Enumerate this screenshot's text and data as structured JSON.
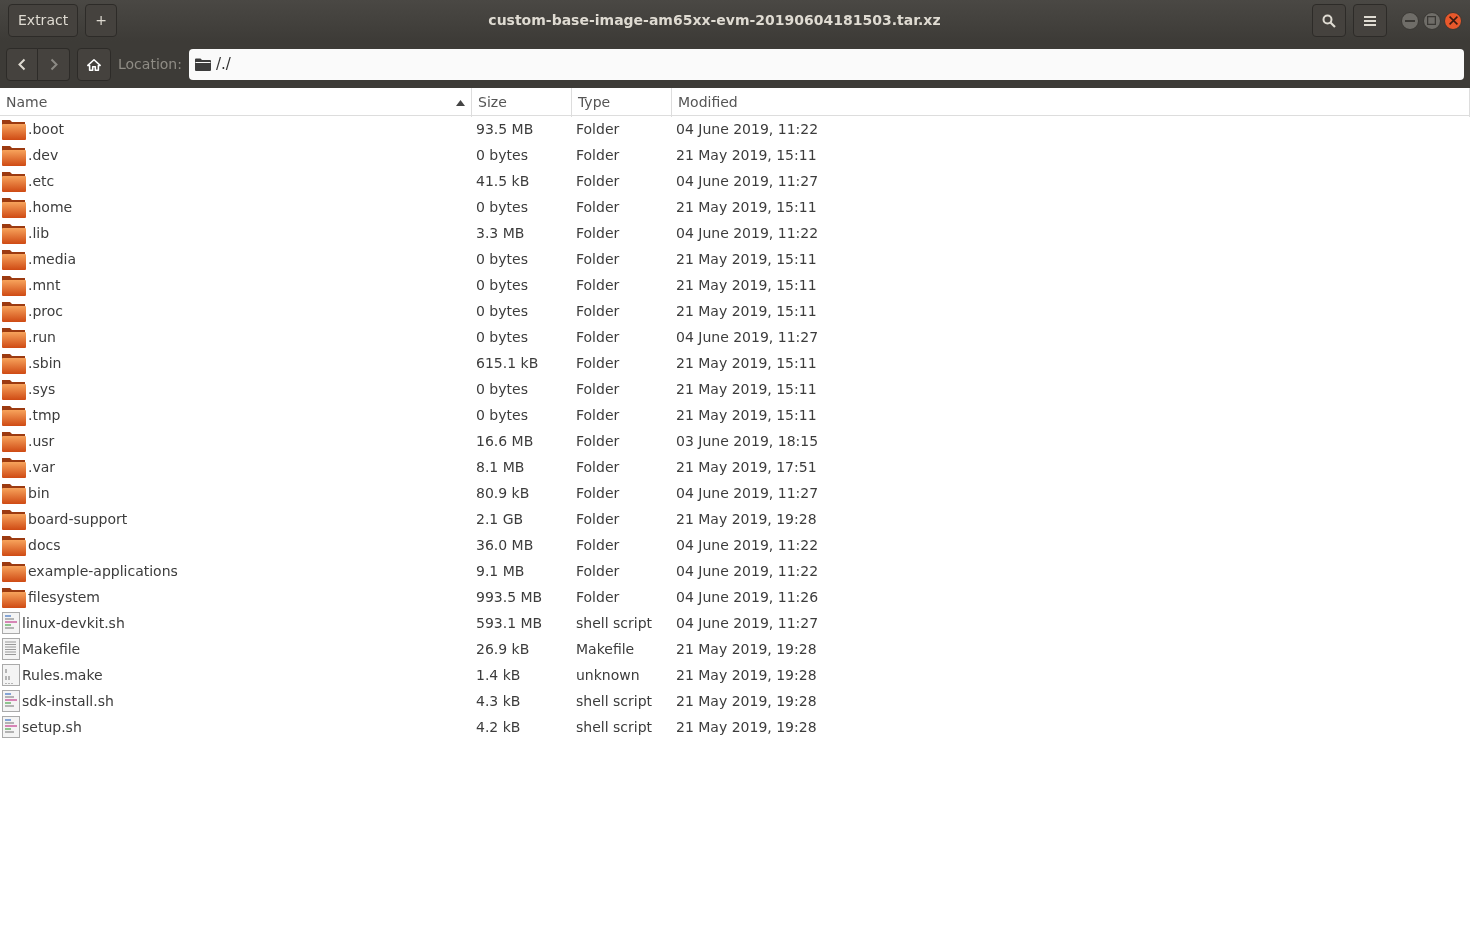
{
  "window": {
    "title": "custom-base-image-am65xx-evm-20190604181503.tar.xz"
  },
  "header_buttons": [
    {
      "label": "Extract",
      "kind": "text"
    },
    {
      "label": "+",
      "kind": "text"
    }
  ],
  "toolbar": {
    "location_label": "Location:",
    "path": "/./"
  },
  "table": {
    "columns": [
      {
        "label": "Name",
        "sorted": true
      },
      {
        "label": "Size",
        "sorted": false
      },
      {
        "label": "Type",
        "sorted": false
      },
      {
        "label": "Modified",
        "sorted": false
      }
    ],
    "rows": [
      {
        "kind": "folder",
        "name": ".boot",
        "size": "93.5 MB",
        "type": "Folder",
        "modified": "04 June 2019, 11:22"
      },
      {
        "kind": "folder",
        "name": ".dev",
        "size": "0 bytes",
        "type": "Folder",
        "modified": "21 May 2019, 15:11"
      },
      {
        "kind": "folder",
        "name": ".etc",
        "size": "41.5 kB",
        "type": "Folder",
        "modified": "04 June 2019, 11:27"
      },
      {
        "kind": "folder",
        "name": ".home",
        "size": "0 bytes",
        "type": "Folder",
        "modified": "21 May 2019, 15:11"
      },
      {
        "kind": "folder",
        "name": ".lib",
        "size": "3.3 MB",
        "type": "Folder",
        "modified": "04 June 2019, 11:22"
      },
      {
        "kind": "folder",
        "name": ".media",
        "size": "0 bytes",
        "type": "Folder",
        "modified": "21 May 2019, 15:11"
      },
      {
        "kind": "folder",
        "name": ".mnt",
        "size": "0 bytes",
        "type": "Folder",
        "modified": "21 May 2019, 15:11"
      },
      {
        "kind": "folder",
        "name": ".proc",
        "size": "0 bytes",
        "type": "Folder",
        "modified": "21 May 2019, 15:11"
      },
      {
        "kind": "folder",
        "name": ".run",
        "size": "0 bytes",
        "type": "Folder",
        "modified": "04 June 2019, 11:27"
      },
      {
        "kind": "folder",
        "name": ".sbin",
        "size": "615.1 kB",
        "type": "Folder",
        "modified": "21 May 2019, 15:11"
      },
      {
        "kind": "folder",
        "name": ".sys",
        "size": "0 bytes",
        "type": "Folder",
        "modified": "21 May 2019, 15:11"
      },
      {
        "kind": "folder",
        "name": ".tmp",
        "size": "0 bytes",
        "type": "Folder",
        "modified": "21 May 2019, 15:11"
      },
      {
        "kind": "folder",
        "name": ".usr",
        "size": "16.6 MB",
        "type": "Folder",
        "modified": "03 June 2019, 18:15"
      },
      {
        "kind": "folder",
        "name": ".var",
        "size": "8.1 MB",
        "type": "Folder",
        "modified": "21 May 2019, 17:51"
      },
      {
        "kind": "folder",
        "name": "bin",
        "size": "80.9 kB",
        "type": "Folder",
        "modified": "04 June 2019, 11:27"
      },
      {
        "kind": "folder",
        "name": "board-support",
        "size": "2.1 GB",
        "type": "Folder",
        "modified": "21 May 2019, 19:28"
      },
      {
        "kind": "folder",
        "name": "docs",
        "size": "36.0 MB",
        "type": "Folder",
        "modified": "04 June 2019, 11:22"
      },
      {
        "kind": "folder",
        "name": "example-applications",
        "size": "9.1 MB",
        "type": "Folder",
        "modified": "04 June 2019, 11:22"
      },
      {
        "kind": "folder",
        "name": "filesystem",
        "size": "993.5 MB",
        "type": "Folder",
        "modified": "04 June 2019, 11:26"
      },
      {
        "kind": "script",
        "name": "linux-devkit.sh",
        "size": "593.1 MB",
        "type": "shell script",
        "modified": "04 June 2019, 11:27"
      },
      {
        "kind": "text",
        "name": "Makefile",
        "size": "26.9 kB",
        "type": "Makefile",
        "modified": "21 May 2019, 19:28"
      },
      {
        "kind": "binary",
        "name": "Rules.make",
        "size": "1.4 kB",
        "type": "unknown",
        "modified": "21 May 2019, 19:28"
      },
      {
        "kind": "script",
        "name": "sdk-install.sh",
        "size": "4.3 kB",
        "type": "shell script",
        "modified": "21 May 2019, 19:28"
      },
      {
        "kind": "script",
        "name": "setup.sh",
        "size": "4.2 kB",
        "type": "shell script",
        "modified": "21 May 2019, 19:28"
      }
    ]
  }
}
